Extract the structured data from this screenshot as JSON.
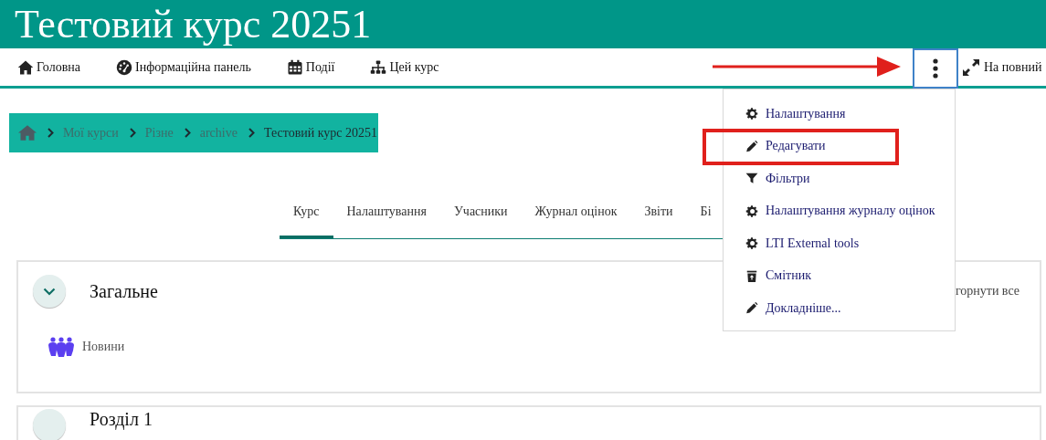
{
  "header": {
    "title": "Тестовий курс 20251"
  },
  "nav": {
    "items": [
      {
        "label": "Головна",
        "kind": "home"
      },
      {
        "label": "Інформаційна панель",
        "kind": "dashboard"
      },
      {
        "label": "Події",
        "kind": "calendar"
      },
      {
        "label": "Цей курс",
        "kind": "sitemap"
      }
    ],
    "more_button": {
      "focused": true
    },
    "fullscreen": {
      "label": "На повний"
    }
  },
  "breadcrumb": [
    {
      "label": "Мої курси",
      "current": false
    },
    {
      "label": "Різне",
      "current": false
    },
    {
      "label": "archive",
      "current": false
    },
    {
      "label": "Тестовий курс 20251",
      "current": true
    }
  ],
  "tabs": [
    {
      "label": "Курс",
      "selected": true
    },
    {
      "label": "Налаштування",
      "selected": false
    },
    {
      "label": "Учасники",
      "selected": false
    },
    {
      "label": "Журнал оцінок",
      "selected": false
    },
    {
      "label": "Звіти",
      "selected": false
    },
    {
      "label": "Бі",
      "selected": false
    }
  ],
  "collapse_all": "горнути все",
  "sections": [
    {
      "title": "Загальне",
      "expanded": true,
      "activities": [
        {
          "name": "Новини"
        }
      ]
    },
    {
      "title": "Розділ 1"
    }
  ],
  "menu": [
    {
      "label": "Налаштування",
      "kind": "gear",
      "annotated": false
    },
    {
      "label": "Редагувати",
      "kind": "pencil",
      "annotated": true
    },
    {
      "label": "Фільтри",
      "kind": "filter",
      "annotated": false
    },
    {
      "label": "Налаштування журналу оцінок",
      "kind": "gear",
      "annotated": false
    },
    {
      "label": "LTI External tools",
      "kind": "gear",
      "annotated": false
    },
    {
      "label": "Смітник",
      "kind": "trash",
      "annotated": false
    },
    {
      "label": "Докладніше...",
      "kind": "pencil",
      "annotated": false
    }
  ]
}
